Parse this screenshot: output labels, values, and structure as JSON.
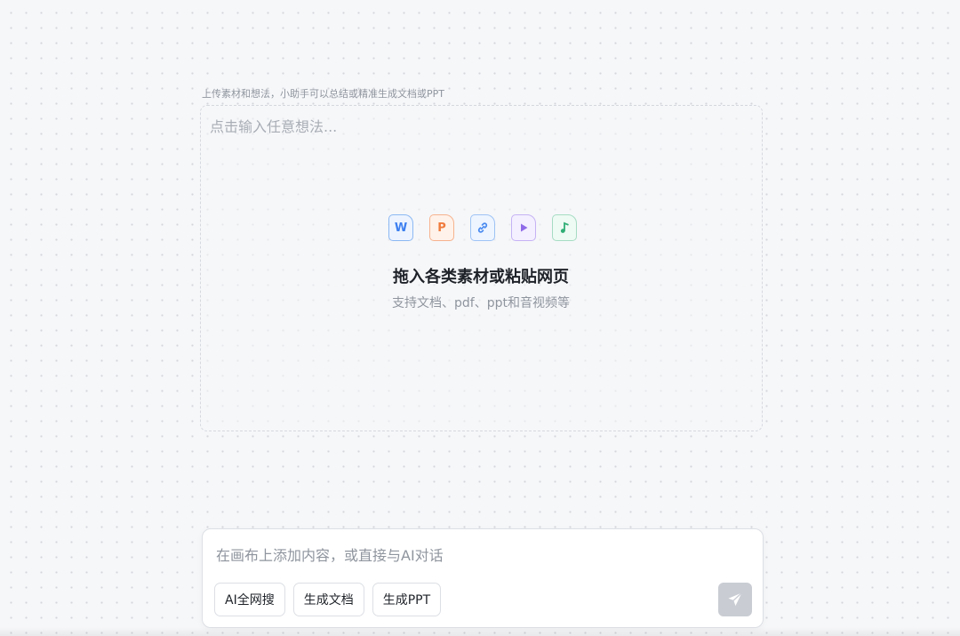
{
  "hint": "上传素材和想法，小助手可以总结或精准生成文档或PPT",
  "drop_zone": {
    "placeholder": "点击输入任意想法...",
    "icons": [
      {
        "name": "word-file-icon",
        "glyph": "W"
      },
      {
        "name": "ppt-file-icon",
        "glyph": "P"
      },
      {
        "name": "link-file-icon"
      },
      {
        "name": "video-file-icon"
      },
      {
        "name": "audio-file-icon"
      }
    ],
    "title": "拖入各类素材或粘贴网页",
    "subtitle": "支持文档、pdf、ppt和音视频等"
  },
  "chat": {
    "placeholder": "在画布上添加内容，或直接与AI对话",
    "actions": [
      "AI全网搜",
      "生成文档",
      "生成PPT"
    ],
    "send_icon": "paper-plane-icon"
  },
  "colors": {
    "word": "#3d7ff0",
    "ppt": "#f07b3d",
    "link": "#4a8bf0",
    "video": "#8f6ae8",
    "audio": "#2fae75",
    "send_disabled": "#c9ccd3"
  }
}
